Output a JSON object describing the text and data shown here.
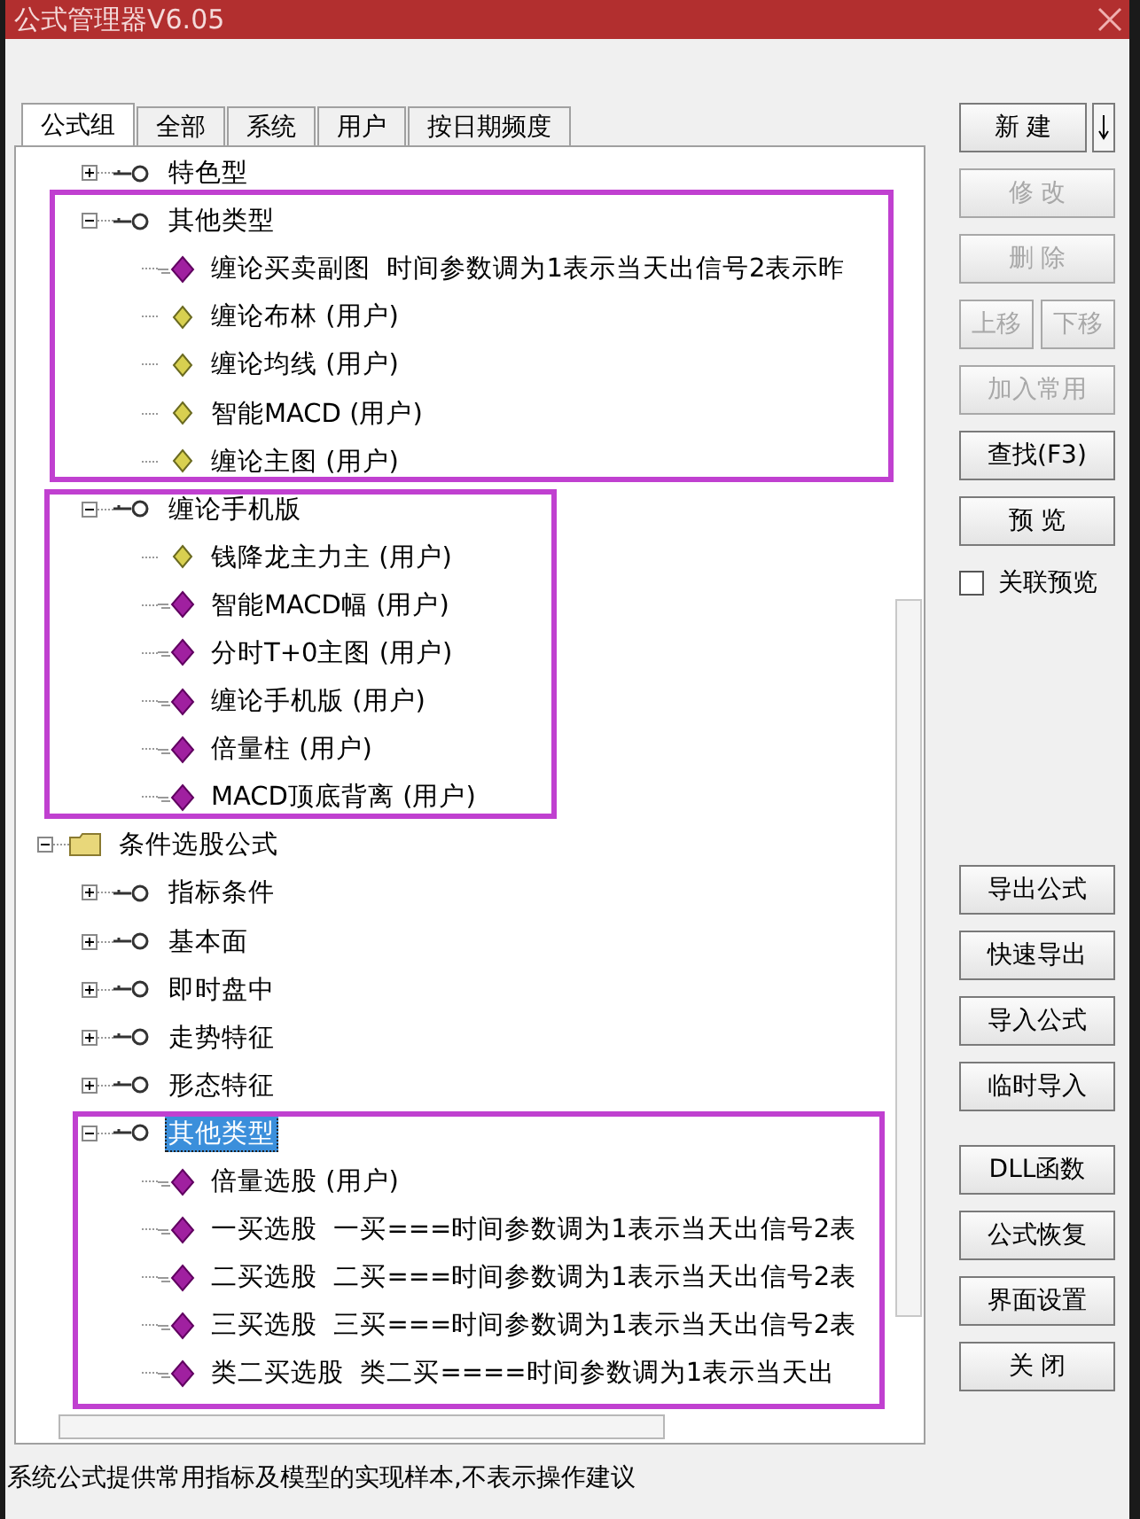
{
  "window": {
    "title": "公式管理器V6.05"
  },
  "tabs": [
    {
      "label": "公式组",
      "selected": true
    },
    {
      "label": "全部",
      "selected": false
    },
    {
      "label": "系统",
      "selected": false
    },
    {
      "label": "用户",
      "selected": false
    },
    {
      "label": "按日期频度",
      "selected": false
    }
  ],
  "tree": {
    "nodes": [
      {
        "kind": "offscreen-group",
        "children": [
          {
            "kind": "group",
            "label": "特色型",
            "expanded": false,
            "selected": false
          },
          {
            "kind": "group",
            "label": "其他类型",
            "expanded": true,
            "selected": false,
            "children": [
              {
                "kind": "indicator",
                "label": "缠论买卖副图  时间参数调为1表示当天出信号2表示昨",
                "selected": false
              },
              {
                "kind": "template",
                "label": "缠论布林 (用户)",
                "selected": false
              },
              {
                "kind": "template",
                "label": "缠论均线 (用户)",
                "selected": false
              },
              {
                "kind": "template",
                "label": "智能MACD (用户)",
                "selected": false
              },
              {
                "kind": "template",
                "label": "缠论主图 (用户)",
                "selected": false
              }
            ]
          },
          {
            "kind": "group",
            "label": "缠论手机版",
            "expanded": true,
            "selected": false,
            "children": [
              {
                "kind": "template",
                "label": "钱降龙主力主 (用户)",
                "selected": false
              },
              {
                "kind": "indicator",
                "label": "智能MACD幅 (用户)",
                "selected": false
              },
              {
                "kind": "indicator",
                "label": "分时T+0主图 (用户)",
                "selected": false
              },
              {
                "kind": "indicator",
                "label": "缠论手机版 (用户)",
                "selected": false
              },
              {
                "kind": "indicator",
                "label": "倍量柱 (用户)",
                "selected": false
              },
              {
                "kind": "indicator",
                "label": "MACD顶底背离 (用户)",
                "selected": false
              }
            ]
          }
        ]
      },
      {
        "kind": "folder",
        "label": "条件选股公式",
        "expanded": true,
        "selected": false,
        "children": [
          {
            "kind": "group",
            "label": "指标条件",
            "expanded": false,
            "selected": false
          },
          {
            "kind": "group",
            "label": "基本面",
            "expanded": false,
            "selected": false
          },
          {
            "kind": "group",
            "label": "即时盘中",
            "expanded": false,
            "selected": false
          },
          {
            "kind": "group",
            "label": "走势特征",
            "expanded": false,
            "selected": false
          },
          {
            "kind": "group",
            "label": "形态特征",
            "expanded": false,
            "selected": false
          },
          {
            "kind": "group",
            "label": "其他类型",
            "expanded": true,
            "selected": true,
            "children": [
              {
                "kind": "indicator",
                "label": "倍量选股 (用户)",
                "selected": false
              },
              {
                "kind": "indicator",
                "label": "一买选股  一买===时间参数调为1表示当天出信号2表",
                "selected": false
              },
              {
                "kind": "indicator",
                "label": "二买选股  二买===时间参数调为1表示当天出信号2表",
                "selected": false
              },
              {
                "kind": "indicator",
                "label": "三买选股  三买===时间参数调为1表示当天出信号2表",
                "selected": false
              },
              {
                "kind": "indicator",
                "label": "类二买选股  类二买====时间参数调为1表示当天出",
                "selected": false
              }
            ]
          }
        ]
      }
    ]
  },
  "button_groups": [
    [
      {
        "kind": "split",
        "label": "新 建",
        "disabled": false
      },
      {
        "kind": "single",
        "label": "修 改",
        "disabled": true
      },
      {
        "kind": "single",
        "label": "删 除",
        "disabled": true
      },
      {
        "kind": "pair",
        "buttons": [
          {
            "label": "上移",
            "disabled": true
          },
          {
            "label": "下移",
            "disabled": true
          }
        ]
      },
      {
        "kind": "single",
        "label": "加入常用",
        "disabled": true
      },
      {
        "kind": "single",
        "label": "查找(F3)",
        "disabled": false
      },
      {
        "kind": "single",
        "label": "预 览",
        "disabled": false
      }
    ],
    [
      {
        "kind": "single",
        "label": "导出公式",
        "disabled": false
      },
      {
        "kind": "single",
        "label": "快速导出",
        "disabled": false
      },
      {
        "kind": "single",
        "label": "导入公式",
        "disabled": false
      },
      {
        "kind": "single",
        "label": "临时导入",
        "disabled": false
      }
    ],
    [
      {
        "kind": "single",
        "label": "DLL函数",
        "disabled": false
      },
      {
        "kind": "single",
        "label": "公式恢复",
        "disabled": false
      },
      {
        "kind": "single",
        "label": "界面设置",
        "disabled": false
      },
      {
        "kind": "single",
        "label": "关 闭",
        "disabled": false
      }
    ]
  ],
  "preview_checkbox": {
    "label": "关联预览",
    "checked": false
  },
  "status_bar": "系统公式提供常用指标及模型的实现样本,不表示操作建议"
}
